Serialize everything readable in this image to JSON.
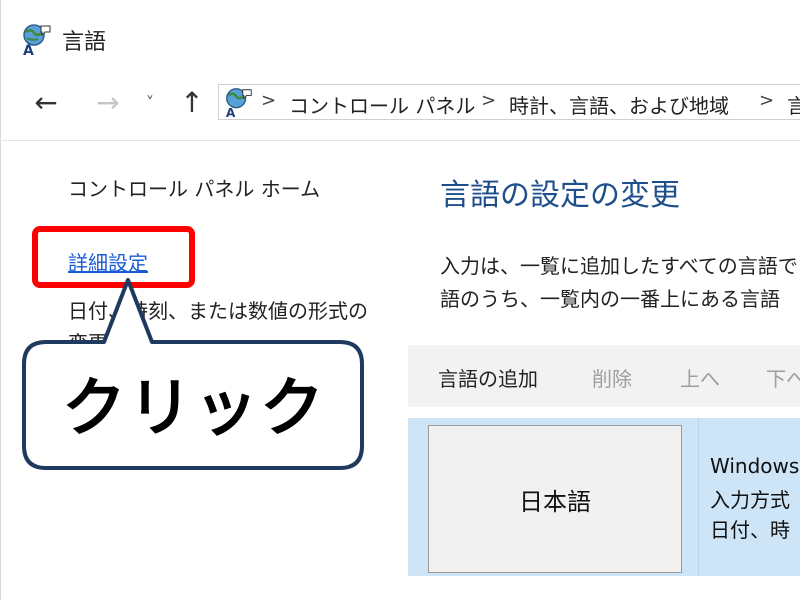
{
  "window": {
    "title": "言語"
  },
  "nav": {
    "back_icon": "←",
    "forward_icon": "→",
    "recent_icon": "˅",
    "up_icon": "↑",
    "breadcrumb": [
      "コントロール パネル",
      "時計、言語、および地域",
      "言"
    ],
    "separator": ">"
  },
  "left_pane": {
    "home": "コントロール パネル ホーム",
    "advanced": "詳細設定",
    "format_line1": "日付、時刻、または数値の形式の",
    "format_line2": "変更"
  },
  "callout": {
    "text": "クリック",
    "highlight_color": "#ff0000"
  },
  "main": {
    "heading": "言語の設定の変更",
    "description_line1": "入力は、一覧に追加したすべての言語で",
    "description_line2": "語のうち、一覧内の一番上にある言語",
    "toolbar": {
      "add": "言語の追加",
      "remove": "削除",
      "up": "上へ",
      "down": "下へ"
    },
    "language": {
      "name": "日本語",
      "info_line1": "Windows",
      "info_line2": "入力方式",
      "info_line3": "日付、時"
    }
  },
  "colors": {
    "heading": "#1e4e8c",
    "link": "#1a5cd6",
    "selected_row": "#cde5f7"
  }
}
